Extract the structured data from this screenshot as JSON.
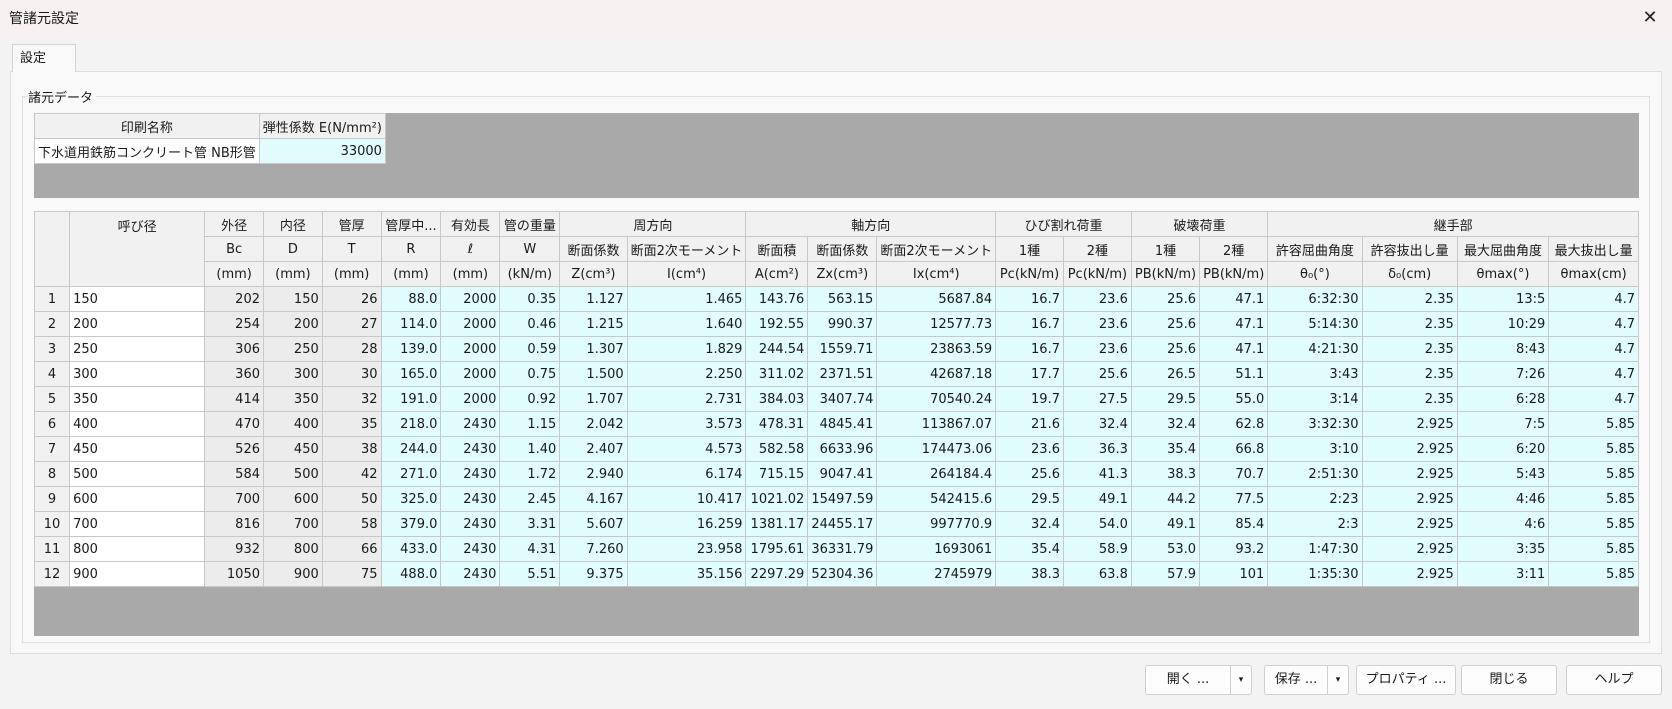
{
  "window": {
    "title": "管諸元設定",
    "close_glyph": "✕"
  },
  "tab": {
    "label": "設定"
  },
  "group": {
    "label": "諸元データ"
  },
  "top_table": {
    "headers": [
      "印刷名称",
      "弾性係数 E(N/mm²)"
    ],
    "row": {
      "name": "下水道用鉄筋コンクリート管 NB形管",
      "value": "33000"
    }
  },
  "main_table": {
    "header_groups": {
      "circ": "周方向",
      "axial": "軸方向",
      "crack": "ひび割れ荷重",
      "break": "破壊荷重",
      "joint": "継手部"
    },
    "headers": {
      "nominal": "呼び径",
      "outer": [
        "外径",
        "Bc",
        "(mm)"
      ],
      "inner": [
        "内径",
        "D",
        "(mm)"
      ],
      "thick": [
        "管厚",
        "T",
        "(mm)"
      ],
      "mid": [
        "管厚中...",
        "R",
        "(mm)"
      ],
      "len": [
        "有効長",
        "ℓ",
        "(mm)"
      ],
      "weight": [
        "管の重量",
        "W",
        "(kN/m)"
      ],
      "circ_z": [
        "断面係数",
        "Z(cm³)"
      ],
      "circ_i": [
        "断面2次モーメント",
        "I(cm⁴)"
      ],
      "ax_a": [
        "断面積",
        "A(cm²)"
      ],
      "ax_z": [
        "断面係数",
        "Zx(cm³)"
      ],
      "ax_i": [
        "断面2次モーメント",
        "Ix(cm⁴)"
      ],
      "crack1": [
        "1種",
        "Pc(kN/m)"
      ],
      "crack2": [
        "2種",
        "Pc(kN/m)"
      ],
      "break1": [
        "1種",
        "PB(kN/m)"
      ],
      "break2": [
        "2種",
        "PB(kN/m)"
      ],
      "j_angle": [
        "許容屈曲角度",
        "θ₀(°)"
      ],
      "j_pull": [
        "許容抜出し量",
        "δ₀(cm)"
      ],
      "j_maxangle": [
        "最大屈曲角度",
        "θmax(°)"
      ],
      "j_maxpull": [
        "最大抜出し量",
        "θmax(cm)"
      ]
    },
    "rows": [
      [
        "1",
        "150",
        "202",
        "150",
        "26",
        "88.0",
        "2000",
        "0.35",
        "1.127",
        "1.465",
        "143.76",
        "563.15",
        "5687.84",
        "16.7",
        "23.6",
        "25.6",
        "47.1",
        "6:32:30",
        "2.35",
        "13:5",
        "4.7"
      ],
      [
        "2",
        "200",
        "254",
        "200",
        "27",
        "114.0",
        "2000",
        "0.46",
        "1.215",
        "1.640",
        "192.55",
        "990.37",
        "12577.73",
        "16.7",
        "23.6",
        "25.6",
        "47.1",
        "5:14:30",
        "2.35",
        "10:29",
        "4.7"
      ],
      [
        "3",
        "250",
        "306",
        "250",
        "28",
        "139.0",
        "2000",
        "0.59",
        "1.307",
        "1.829",
        "244.54",
        "1559.71",
        "23863.59",
        "16.7",
        "23.6",
        "25.6",
        "47.1",
        "4:21:30",
        "2.35",
        "8:43",
        "4.7"
      ],
      [
        "4",
        "300",
        "360",
        "300",
        "30",
        "165.0",
        "2000",
        "0.75",
        "1.500",
        "2.250",
        "311.02",
        "2371.51",
        "42687.18",
        "17.7",
        "25.6",
        "26.5",
        "51.1",
        "3:43",
        "2.35",
        "7:26",
        "4.7"
      ],
      [
        "5",
        "350",
        "414",
        "350",
        "32",
        "191.0",
        "2000",
        "0.92",
        "1.707",
        "2.731",
        "384.03",
        "3407.74",
        "70540.24",
        "19.7",
        "27.5",
        "29.5",
        "55.0",
        "3:14",
        "2.35",
        "6:28",
        "4.7"
      ],
      [
        "6",
        "400",
        "470",
        "400",
        "35",
        "218.0",
        "2430",
        "1.15",
        "2.042",
        "3.573",
        "478.31",
        "4845.41",
        "113867.07",
        "21.6",
        "32.4",
        "32.4",
        "62.8",
        "3:32:30",
        "2.925",
        "7:5",
        "5.85"
      ],
      [
        "7",
        "450",
        "526",
        "450",
        "38",
        "244.0",
        "2430",
        "1.40",
        "2.407",
        "4.573",
        "582.58",
        "6633.96",
        "174473.06",
        "23.6",
        "36.3",
        "35.4",
        "66.8",
        "3:10",
        "2.925",
        "6:20",
        "5.85"
      ],
      [
        "8",
        "500",
        "584",
        "500",
        "42",
        "271.0",
        "2430",
        "1.72",
        "2.940",
        "6.174",
        "715.15",
        "9047.41",
        "264184.4",
        "25.6",
        "41.3",
        "38.3",
        "70.7",
        "2:51:30",
        "2.925",
        "5:43",
        "5.85"
      ],
      [
        "9",
        "600",
        "700",
        "600",
        "50",
        "325.0",
        "2430",
        "2.45",
        "4.167",
        "10.417",
        "1021.02",
        "15497.59",
        "542415.6",
        "29.5",
        "49.1",
        "44.2",
        "77.5",
        "2:23",
        "2.925",
        "4:46",
        "5.85"
      ],
      [
        "10",
        "700",
        "816",
        "700",
        "58",
        "379.0",
        "2430",
        "3.31",
        "5.607",
        "16.259",
        "1381.17",
        "24455.17",
        "997770.9",
        "32.4",
        "54.0",
        "49.1",
        "85.4",
        "2:3",
        "2.925",
        "4:6",
        "5.85"
      ],
      [
        "11",
        "800",
        "932",
        "800",
        "66",
        "433.0",
        "2430",
        "4.31",
        "7.260",
        "23.958",
        "1795.61",
        "36331.79",
        "1693061",
        "35.4",
        "58.9",
        "53.0",
        "93.2",
        "1:47:30",
        "2.925",
        "3:35",
        "5.85"
      ],
      [
        "12",
        "900",
        "1050",
        "900",
        "75",
        "488.0",
        "2430",
        "5.51",
        "9.375",
        "35.156",
        "2297.29",
        "52304.36",
        "2745979",
        "38.3",
        "63.8",
        "57.9",
        "101",
        "1:35:30",
        "2.925",
        "3:11",
        "5.85"
      ]
    ]
  },
  "buttons": {
    "open": "開く ...",
    "save": "保存 ...",
    "properties": "プロパティ ...",
    "close": "閉じる",
    "help": "ヘルプ",
    "dropdown_glyph": "▾"
  }
}
